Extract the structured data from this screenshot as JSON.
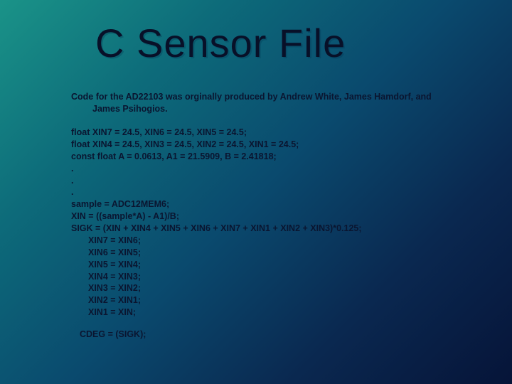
{
  "title": "C Sensor File",
  "credits": {
    "line1": "Code for the AD22103 was orginally produced by  Andrew White, James Hamdorf, and",
    "line2": "James Psihogios."
  },
  "code": {
    "l1": "float XIN7 = 24.5, XIN6 = 24.5, XIN5 = 24.5;",
    "l2": "float XIN4 = 24.5, XIN3 = 24.5, XIN2 = 24.5, XIN1 = 24.5;",
    "l3": "const float A = 0.0613, A1 = 21.5909, B = 2.41818;",
    "d1": ".",
    "d2": ".",
    "d3": ".",
    "l4": "sample = ADC12MEM6;",
    "l5": "XIN = ((sample*A) - A1)/B;",
    "l6": "SIGK = (XIN + XIN4 + XIN5 + XIN6 + XIN7 + XIN1 + XIN2 + XIN3)*0.125;",
    "s1": "XIN7 = XIN6;",
    "s2": "XIN6 = XIN5;",
    "s3": "XIN5 = XIN4;",
    "s4": "XIN4 = XIN3;",
    "s5": "XIN3 = XIN2;",
    "s6": "XIN2 = XIN1;",
    "s7": "XIN1 = XIN;",
    "l7": "CDEG = (SIGK);"
  }
}
